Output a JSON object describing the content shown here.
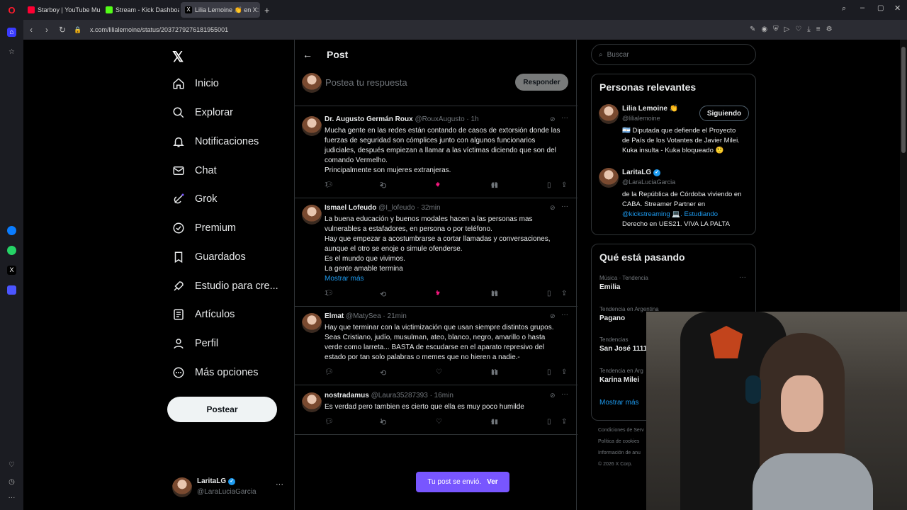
{
  "browser": {
    "tabs": [
      {
        "label": "Starboy | YouTube Mu",
        "color": "#ff0033"
      },
      {
        "label": "Stream - Kick Dashboard",
        "color": "#53fc18"
      },
      {
        "label": "Lilia Lemoine 👏 en X: \"©",
        "color": "#ffffff"
      }
    ],
    "url": "x.com/lilialemoine/status/2037279276181955001"
  },
  "nav": {
    "items": [
      "Inicio",
      "Explorar",
      "Notificaciones",
      "Chat",
      "Grok",
      "Premium",
      "Guardados",
      "Estudio para cre...",
      "Artículos",
      "Perfil",
      "Más opciones"
    ],
    "post_button": "Postear",
    "me_name": "LaritaLG",
    "me_handle": "@LaraLuciaGarcia"
  },
  "header": {
    "title": "Post"
  },
  "reply": {
    "placeholder": "Postea tu respuesta",
    "button": "Responder"
  },
  "tweets": [
    {
      "name": "Dr. Augusto Germán Roux",
      "meta": "@RouxAugusto · 1h",
      "lines": [
        "Mucha gente en las redes están contando de casos de extorsión donde las",
        "fuerzas de seguridad son cómplices junto con algunos funcionarios",
        "judiciales, después empiezan a llamar a las víctimas diciendo que son del",
        "comando Vermelho.",
        "Principalmente son mujeres extranjeras."
      ],
      "more": "",
      "replies": "1",
      "reposts": "2",
      "likes": "4",
      "views": "48",
      "liked": true
    },
    {
      "name": "Ismael Lofeudo",
      "meta": "@I_lofeudo · 32min",
      "lines": [
        "La buena educación y buenos modales hacen a las personas mas",
        "vulnerables a estafadores, en persona o por teléfono.",
        "Hay que empezar a acostumbrarse a cortar llamadas y conversaciones,",
        "aunque el otro se enoje o simule ofenderse.",
        "Es el mundo que vivimos.",
        "La gente amable termina"
      ],
      "more": "Mostrar más",
      "replies": "1",
      "reposts": "",
      "likes": "1",
      "views": "16",
      "liked": true
    },
    {
      "name": "Elmat",
      "meta": "@MatySea · 21min",
      "lines": [
        "Hay que terminar con la victimización que usan siempre distintos grupos.",
        "Seas Cristiano, judío, musulman, ateo, blanco, negro, amarillo o hasta",
        "verde como larreta... BASTA de escudarse en el aparato represivo del",
        "estado por tan solo palabras o memes que no hieren a nadie.-"
      ],
      "more": "",
      "replies": "",
      "reposts": "",
      "likes": "",
      "views": "11",
      "liked": false
    },
    {
      "name": "nostradamus",
      "meta": "@Laura35287393 · 16min",
      "lines": [
        "Es verdad pero tambien es cierto que ella es muy poco humilde"
      ],
      "more": "",
      "replies": "",
      "reposts": "1",
      "likes": "",
      "views": "4",
      "liked": false
    }
  ],
  "toast": {
    "text": "Tu post se envió.",
    "action": "Ver"
  },
  "right": {
    "search_placeholder": "Buscar",
    "relevant_title": "Personas relevantes",
    "people": [
      {
        "name": "Lilia Lemoine 👏",
        "handle": "@lilialemoine",
        "button": "Siguiendo",
        "bio": [
          "🇦🇷 Diputada que defiende el Proyecto",
          "de País de los Votantes de Javier Milei.",
          "Kuka insulta - Kuka bloqueado 🤨"
        ]
      },
      {
        "name": "LaritaLG",
        "handle": "@LaraLuciaGarcia",
        "button": "",
        "bio": [
          "de la República de Córdoba viviendo en",
          "CABA. Streamer Partner en",
          "@kickstreaming 💻. Estudiando",
          "Derecho en UES21. VIVA LA PALTA"
        ]
      }
    ],
    "trends_title": "Qué está pasando",
    "trends": [
      {
        "cat": "Música · Tendencia",
        "t": "Emilia"
      },
      {
        "cat": "Tendencia en Argentina",
        "t": "Pagano"
      },
      {
        "cat": "Tendencias",
        "t": "San José 1111"
      },
      {
        "cat": "Tendencia en Arg",
        "t": "Karina Milei"
      }
    ],
    "show_more": "Mostrar más",
    "footer": [
      "Condiciones de Serv",
      "Política de cookies",
      "Información de anu",
      "© 2026 X Corp."
    ]
  },
  "colors": {
    "accent": "#1d9bf0",
    "like": "#f91880",
    "toast": "#7856ff"
  }
}
